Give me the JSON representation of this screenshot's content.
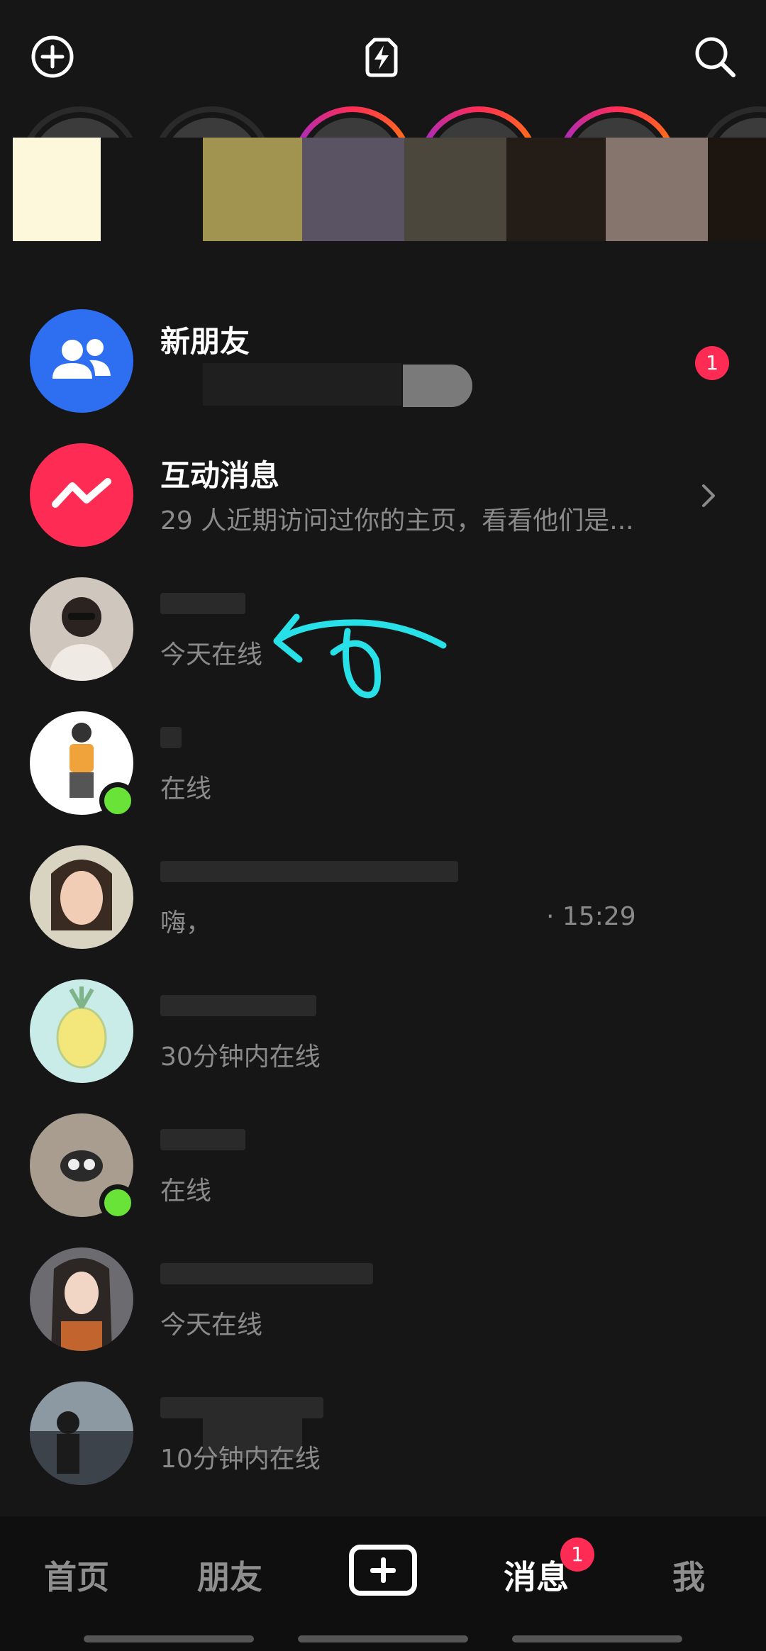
{
  "topbar": {
    "left_icon": "add-circle-icon",
    "center_icon": "flash-camera-icon",
    "right_icon": "search-icon"
  },
  "rows": [
    {
      "title": "新朋友",
      "subtitle": "",
      "badge": "1",
      "avatar_icon": "friends-group-icon",
      "accent": "#2d6ff0"
    },
    {
      "title": "互动消息",
      "subtitle": "29 人近期访问过你的主页，看看他们是...",
      "avatar_icon": "zigzag-message-icon",
      "accent": "#fe2c55"
    },
    {
      "title": "",
      "subtitle": "今天在线"
    },
    {
      "title": "",
      "subtitle": "在线",
      "online": true
    },
    {
      "title": "",
      "subtitle": "嗨，",
      "time": "· 15:29"
    },
    {
      "title": "",
      "subtitle": "30分钟内在线"
    },
    {
      "title": "",
      "subtitle": "在线",
      "online": true
    },
    {
      "title": "",
      "subtitle": "今天在线"
    },
    {
      "title": "",
      "subtitle": "10分钟内在线"
    }
  ],
  "nav": {
    "home": "首页",
    "friends": "朋友",
    "create_icon": "plus-box-icon",
    "messages": "消息",
    "messages_badge": "1",
    "me": "我"
  },
  "colors": {
    "background": "#161616",
    "badge": "#fe2c55",
    "online": "#69e338",
    "annotation": "#27e0e8"
  }
}
